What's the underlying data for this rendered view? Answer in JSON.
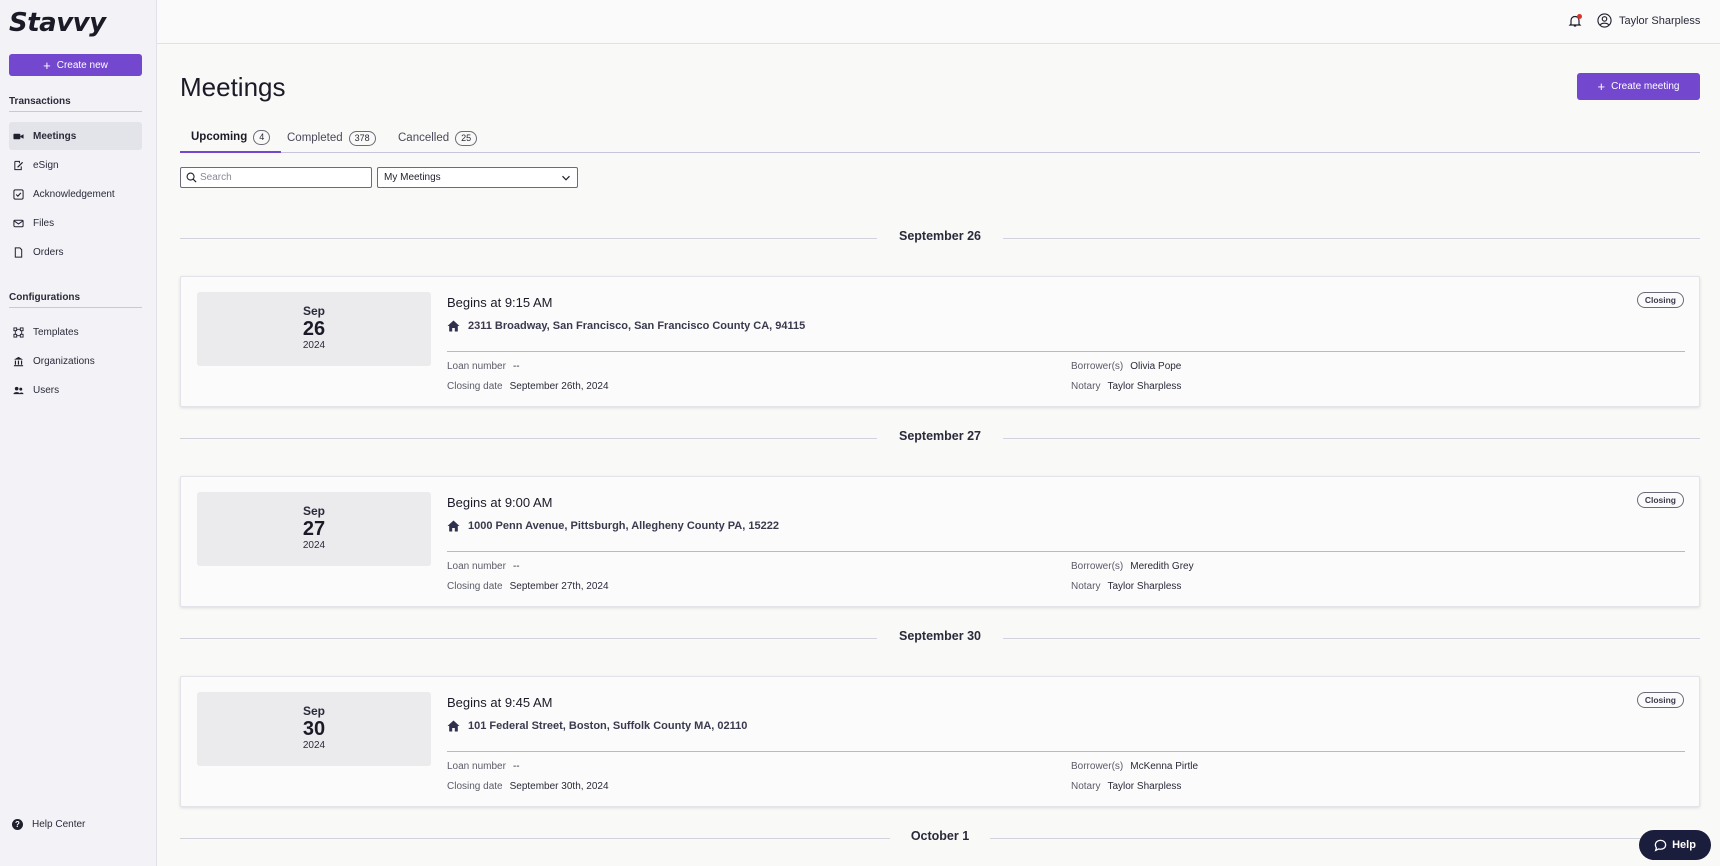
{
  "app": {
    "logo": "Stavvy"
  },
  "sidebar": {
    "create_label": "Create new",
    "transactions_title": "Transactions",
    "configurations_title": "Configurations",
    "items": [
      {
        "label": "Meetings",
        "icon": "video-icon",
        "active": true
      },
      {
        "label": "eSign",
        "icon": "sign-icon"
      },
      {
        "label": "Acknowledgement",
        "icon": "checkbox-icon"
      },
      {
        "label": "Files",
        "icon": "envelope-icon"
      },
      {
        "label": "Orders",
        "icon": "document-icon"
      }
    ],
    "config_items": [
      {
        "label": "Templates",
        "icon": "template-icon"
      },
      {
        "label": "Organizations",
        "icon": "bank-icon"
      },
      {
        "label": "Users",
        "icon": "users-icon"
      }
    ],
    "help_center": "Help Center"
  },
  "header": {
    "user_name": "Taylor Sharpless"
  },
  "main": {
    "title": "Meetings",
    "create_meeting": "Create meeting",
    "tabs": [
      {
        "label": "Upcoming",
        "count": "4",
        "active": true
      },
      {
        "label": "Completed",
        "count": "378"
      },
      {
        "label": "Cancelled",
        "count": "25"
      }
    ],
    "search_placeholder": "Search",
    "filter_value": "My Meetings"
  },
  "groups": [
    {
      "heading": "September 26",
      "meeting": {
        "month": "Sep",
        "day": "26",
        "year": "2024",
        "begins": "Begins at 9:15 AM",
        "address": "2311 Broadway, San Francisco, San Francisco County CA, 94115",
        "loan_label": "Loan number",
        "loan_value": "--",
        "closing_label": "Closing date",
        "closing_value": "September 26th, 2024",
        "borrower_label": "Borrower(s)",
        "borrower_value": "Olivia Pope",
        "notary_label": "Notary",
        "notary_value": "Taylor Sharpless",
        "badge": "Closing"
      }
    },
    {
      "heading": "September 27",
      "meeting": {
        "month": "Sep",
        "day": "27",
        "year": "2024",
        "begins": "Begins at 9:00 AM",
        "address": "1000 Penn Avenue, Pittsburgh, Allegheny County PA, 15222",
        "loan_label": "Loan number",
        "loan_value": "--",
        "closing_label": "Closing date",
        "closing_value": "September 27th, 2024",
        "borrower_label": "Borrower(s)",
        "borrower_value": "Meredith Grey",
        "notary_label": "Notary",
        "notary_value": "Taylor Sharpless",
        "badge": "Closing"
      }
    },
    {
      "heading": "September 30",
      "meeting": {
        "month": "Sep",
        "day": "30",
        "year": "2024",
        "begins": "Begins at 9:45 AM",
        "address": "101 Federal Street, Boston, Suffolk County MA, 02110",
        "loan_label": "Loan number",
        "loan_value": "--",
        "closing_label": "Closing date",
        "closing_value": "September 30th, 2024",
        "borrower_label": "Borrower(s)",
        "borrower_value": "McKenna Pirtle",
        "notary_label": "Notary",
        "notary_value": "Taylor Sharpless",
        "badge": "Closing"
      }
    },
    {
      "heading": "October 1"
    }
  ],
  "help_button": "Help",
  "colors": {
    "accent": "#7447cf",
    "help_bg": "#1a1d3b",
    "notify_dot": "#d9342b"
  }
}
